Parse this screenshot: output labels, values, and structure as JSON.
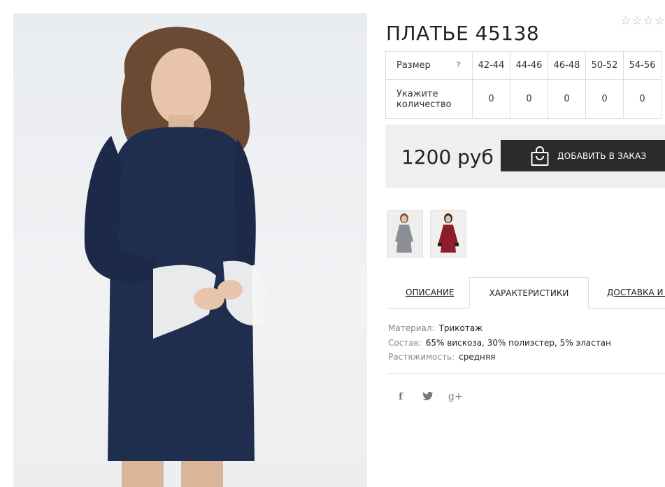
{
  "product": {
    "title": "ПЛАТЬЕ 45138",
    "rating_stars": "☆☆☆☆"
  },
  "sizes_table": {
    "size_label": "Размер",
    "help_icon": "?",
    "sizes": [
      "42-44",
      "44-46",
      "46-48",
      "50-52",
      "54-56"
    ],
    "qty_label_line1": "Укажите",
    "qty_label_line2": "количество",
    "quantities": [
      "0",
      "0",
      "0",
      "0",
      "0"
    ]
  },
  "price": {
    "value": "1200 руб",
    "add_to_order": "ДОБАВИТЬ В ЗАКАЗ",
    "button_color": "#2b2b2b",
    "block_bg": "#efefef"
  },
  "thumbnails": [
    {
      "name": "grey-dress-thumbnail",
      "dress_color": "#8b8f95"
    },
    {
      "name": "burgundy-dress-thumbnail",
      "dress_color": "#8c1d2c"
    }
  ],
  "tabs": {
    "description": "ОПИСАНИЕ",
    "characteristics": "ХАРАКТЕРИСТИКИ",
    "delivery": "ДОСТАВКА И С"
  },
  "properties": [
    {
      "key": "Материал:",
      "value": "Трикотаж"
    },
    {
      "key": "Состав:",
      "value": "65% вискоза, 30% полиэстер, 5% эластан"
    },
    {
      "key": "Растяжимость:",
      "value": "средняя"
    }
  ],
  "social": {
    "facebook": "f",
    "twitter": "🐦",
    "gplus": "g+"
  },
  "main_photo": {
    "dress_color": "#1f2d4f",
    "lace_color": "#f4f4f4"
  }
}
